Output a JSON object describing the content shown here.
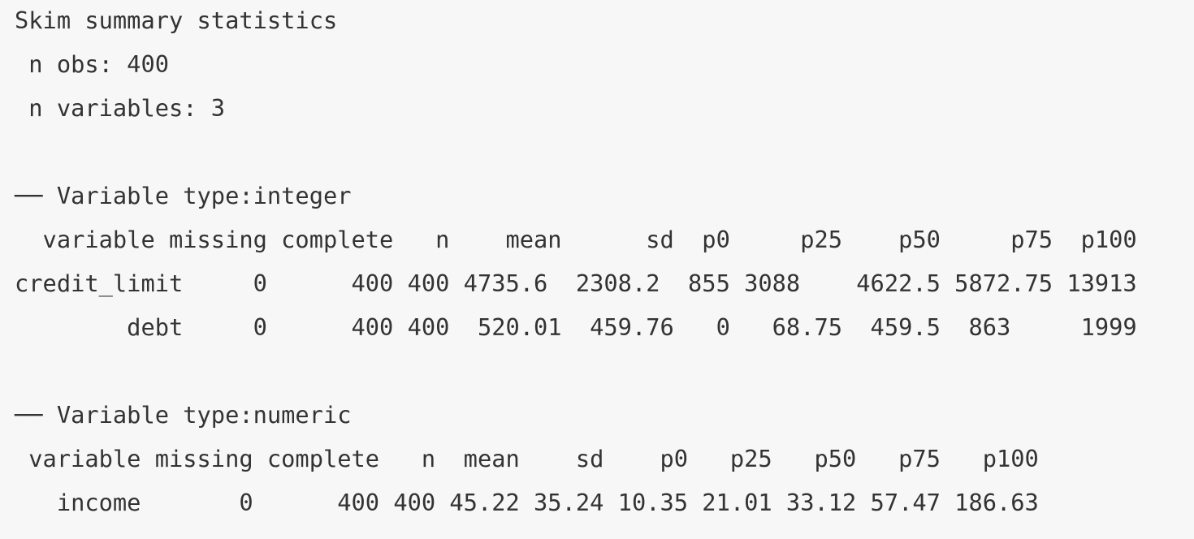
{
  "output": {
    "title": "Skim summary statistics",
    "n_obs": " n obs: 400",
    "n_vars": " n variables: 3",
    "integer_header": "── Variable type:integer",
    "integer_columns": "  variable missing complete   n    mean      sd  p0     p25    p50     p75  p100",
    "integer_rows": [
      "credit_limit     0      400 400 4735.6  2308.2  855 3088    4622.5 5872.75 13913",
      "        debt     0      400 400  520.01  459.76   0   68.75  459.5  863     1999"
    ],
    "numeric_header": "── Variable type:numeric",
    "numeric_columns": " variable missing complete   n  mean    sd    p0   p25   p50   p75   p100",
    "numeric_rows": [
      "   income       0      400 400 45.22 35.24 10.35 21.01 33.12 57.47 186.63"
    ]
  }
}
